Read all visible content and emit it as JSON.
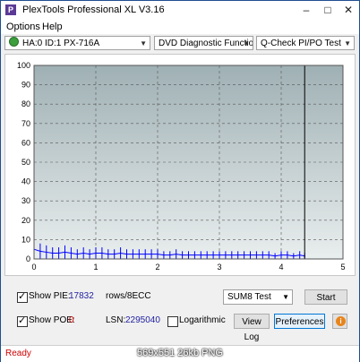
{
  "window": {
    "title": "PlexTools Professional XL V3.16",
    "icon_letter": "P"
  },
  "menu": {
    "items": [
      "Options",
      "Help"
    ]
  },
  "toolbar": {
    "drive": "HA:0 ID:1  PX-716A",
    "function": "DVD Diagnostic Functions",
    "test": "Q-Check PI/PO Test"
  },
  "chart_data": {
    "type": "line",
    "x_ticks": [
      "0",
      "1",
      "2",
      "3",
      "4",
      "5"
    ],
    "y_ticks": [
      "0",
      "10",
      "20",
      "30",
      "40",
      "50",
      "60",
      "70",
      "80",
      "90",
      "100"
    ],
    "xlim": [
      0,
      5
    ],
    "ylim": [
      0,
      100
    ],
    "grid": true,
    "end_marker_x": 4.38,
    "series": [
      {
        "color": "#0000ff",
        "x": [
          0,
          0.1,
          0.2,
          0.3,
          0.4,
          0.5,
          0.6,
          0.7,
          0.8,
          0.9,
          1.0,
          1.1,
          1.2,
          1.3,
          1.4,
          1.5,
          1.6,
          1.7,
          1.8,
          1.9,
          2.0,
          2.1,
          2.2,
          2.3,
          2.4,
          2.5,
          2.6,
          2.7,
          2.8,
          2.9,
          3.0,
          3.1,
          3.2,
          3.3,
          3.4,
          3.5,
          3.6,
          3.7,
          3.8,
          3.9,
          4.0,
          4.1,
          4.2,
          4.3,
          4.38
        ],
        "y": [
          10,
          8,
          7,
          6,
          6,
          7,
          6,
          5,
          6,
          5,
          6,
          6,
          5,
          5,
          6,
          5,
          5,
          5,
          5,
          5,
          5,
          4,
          4,
          5,
          4,
          4,
          4,
          4,
          4,
          4,
          4,
          4,
          4,
          4,
          4,
          4,
          4,
          4,
          4,
          3,
          4,
          4,
          3,
          4,
          3
        ]
      }
    ]
  },
  "controls": {
    "show_pie_label": "Show PIE:",
    "pie_value": "17832",
    "pie_unit": "rows/8ECC",
    "show_poe_label": "Show POE:",
    "poe_value": "0",
    "lsn_label": "LSN:",
    "lsn_value": "2295040",
    "logarithmic_label": "Logarithmic",
    "test_mode": "SUM8 Test",
    "start_label": "Start",
    "view_log_label": "View Log",
    "preferences_label": "Preferences"
  },
  "status": {
    "text": "Ready"
  },
  "watermark": "569x551  26kb  PNG"
}
